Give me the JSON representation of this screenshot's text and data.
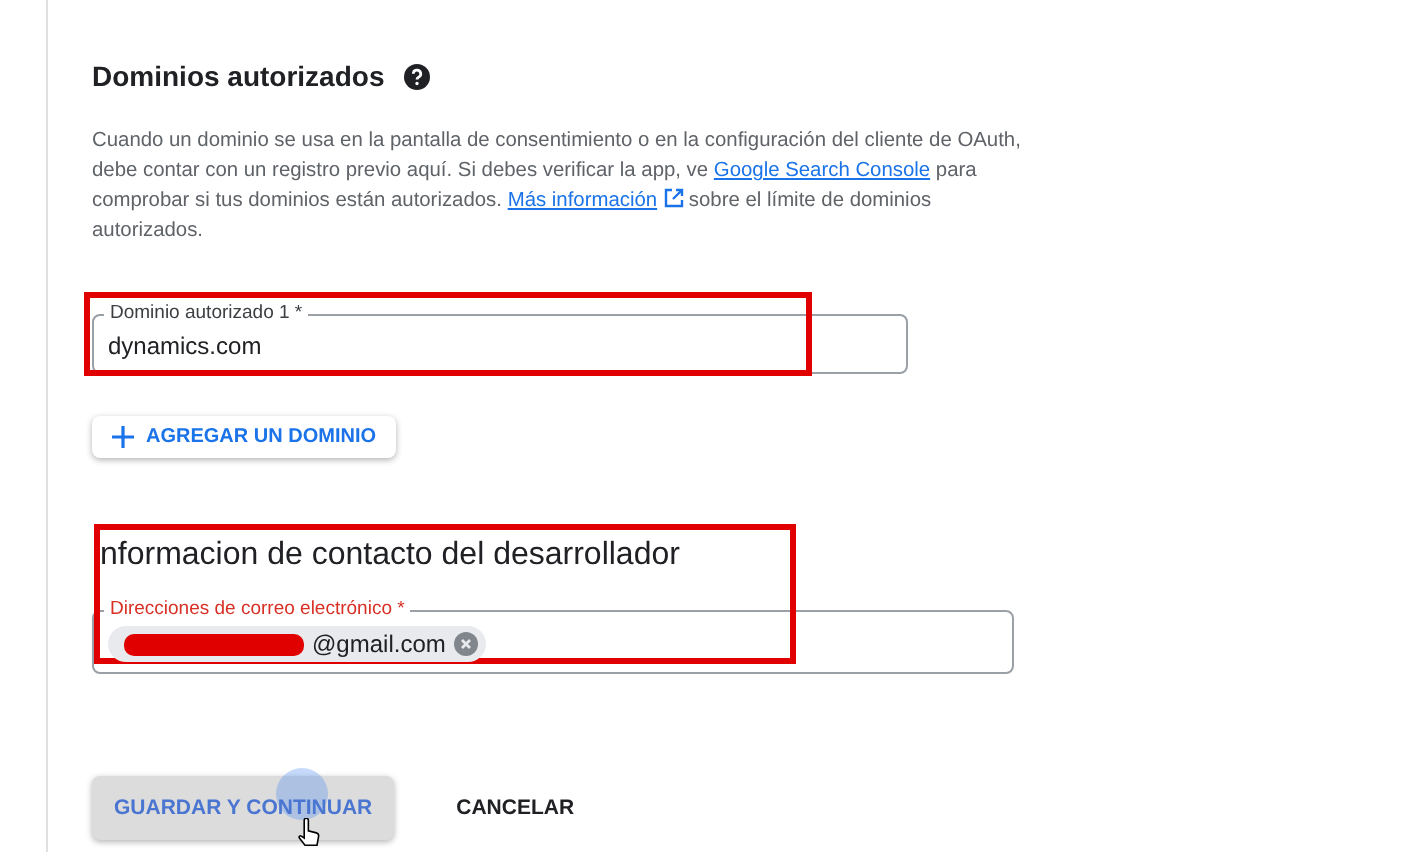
{
  "domains_section": {
    "title": "Dominios autorizados",
    "description_parts": [
      {
        "kind": "text",
        "text": "Cuando un dominio se usa en la pantalla de consentimiento o en la configuración del cliente de OAuth, debe contar con un registro previo aquí. Si debes verificar la app, ve "
      },
      {
        "kind": "link",
        "text": "Google Search Console"
      },
      {
        "kind": "text",
        "text": " para comprobar si tus dominios están autorizados. "
      },
      {
        "kind": "external_link",
        "text": "Más información"
      },
      {
        "kind": "text",
        "text": " sobre el límite de dominios autorizados."
      }
    ],
    "fields": [
      {
        "label": "Dominio autorizado 1 *",
        "value": "dynamics.com"
      }
    ],
    "add_button": "AGREGAR UN DOMINIO"
  },
  "contact_section": {
    "title": "nformacion de contacto del desarrollador",
    "field": {
      "label": "Direcciones de correo electrónico *",
      "chips": [
        {
          "text": "@gmail.com",
          "redacted": true
        }
      ]
    }
  },
  "buttons": [
    {
      "label": "GUARDAR Y CONTINUAR",
      "kind": "raised",
      "pressed": true
    },
    {
      "label": "CANCELAR",
      "kind": "flat",
      "pressed": false
    }
  ]
}
